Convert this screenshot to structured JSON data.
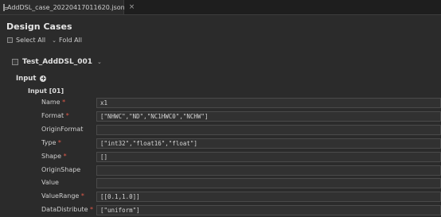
{
  "tab": {
    "title": "AddDSL_case_20220417011620.json",
    "close": "×"
  },
  "page": {
    "title": "Design Cases"
  },
  "toolbar": {
    "select_all": "Select All",
    "fold_all": "Fold All"
  },
  "case": {
    "name": "Test_AddDSL_001"
  },
  "input_section": {
    "label": "Input",
    "sub_label": "Input [01]"
  },
  "fields": [
    {
      "label": "Name",
      "required": true,
      "value": "x1"
    },
    {
      "label": "Format",
      "required": true,
      "value": "[\"NHWC\",\"ND\",\"NC1HWC0\",\"NCHW\"]"
    },
    {
      "label": "OriginFormat",
      "required": false,
      "value": ""
    },
    {
      "label": "Type",
      "required": true,
      "value": "[\"int32\",\"float16\",\"float\"]"
    },
    {
      "label": "Shape",
      "required": true,
      "value": "[]"
    },
    {
      "label": "OriginShape",
      "required": false,
      "value": ""
    },
    {
      "label": "Value",
      "required": false,
      "value": ""
    },
    {
      "label": "ValueRange",
      "required": true,
      "value": "[[0.1,1.0]]"
    },
    {
      "label": "DataDistribute",
      "required": true,
      "value": "[\"uniform\"]"
    }
  ]
}
